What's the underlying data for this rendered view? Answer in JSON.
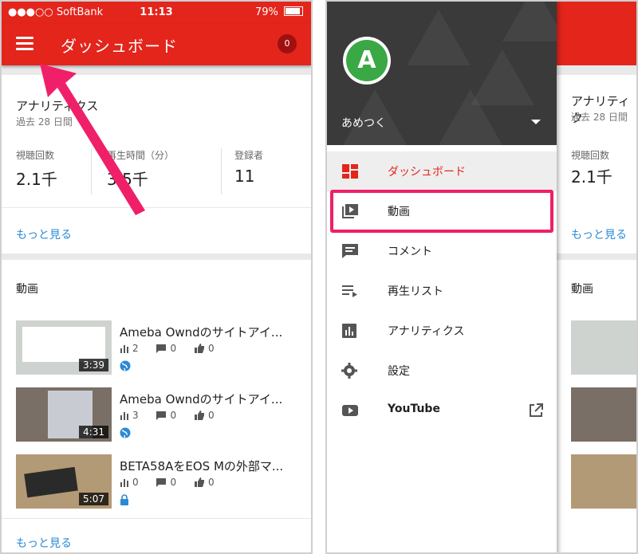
{
  "left": {
    "status": {
      "carrier": "●●●○○ SoftBank",
      "time": "11:13",
      "battery": "79%"
    },
    "appbar": {
      "title": "ダッシュボード",
      "notifications": "0"
    },
    "analytics": {
      "title": "アナリティクス",
      "period": "過去 28 日間",
      "stats": [
        {
          "label": "視聴回数",
          "value": "2.1千"
        },
        {
          "label": "再生時間（分）",
          "value": "3.5千"
        },
        {
          "label": "登録者",
          "value": "11"
        }
      ],
      "more": "もっと見る"
    },
    "videos": {
      "title": "動画",
      "items": [
        {
          "title": "Ameba Owndのサイトアイ...",
          "duration": "3:39",
          "views": "2",
          "comments": "0",
          "likes": "0",
          "visibility": "public"
        },
        {
          "title": "Ameba Owndのサイトアイ...",
          "duration": "4:31",
          "views": "3",
          "comments": "0",
          "likes": "0",
          "visibility": "public"
        },
        {
          "title": "BETA58AをEOS Mの外部マ...",
          "duration": "5:07",
          "views": "0",
          "comments": "0",
          "likes": "0",
          "visibility": "private"
        }
      ],
      "more": "もっと見る"
    }
  },
  "right": {
    "drawer": {
      "avatar_letter": "A",
      "account": "あめつく",
      "items": [
        {
          "label": "ダッシュボード",
          "icon": "dashboard-icon"
        },
        {
          "label": "動画",
          "icon": "video-library-icon"
        },
        {
          "label": "コメント",
          "icon": "comment-icon"
        },
        {
          "label": "再生リスト",
          "icon": "playlist-icon"
        },
        {
          "label": "アナリティクス",
          "icon": "analytics-icon"
        },
        {
          "label": "設定",
          "icon": "gear-icon"
        },
        {
          "label": "YouTube",
          "icon": "youtube-icon"
        }
      ]
    },
    "peek": {
      "analytics_title": "アナリティク",
      "period": "過去 28 日間",
      "stat_label": "視聴回数",
      "stat_value": "2.1千",
      "more": "もっと見る",
      "videos_title": "動画"
    }
  },
  "colors": {
    "accent": "#e3251c",
    "link": "#2b8ad6",
    "highlight": "#f01f6a",
    "avatar": "#3aa845"
  }
}
